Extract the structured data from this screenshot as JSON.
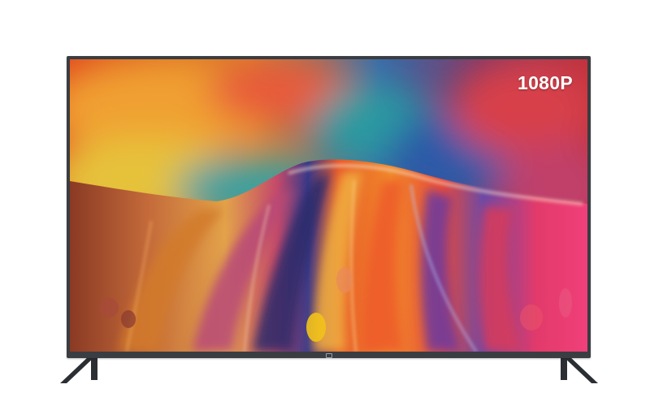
{
  "screen": {
    "resolution_label": "1080P"
  },
  "colors": {
    "bezel": "#3a3d42",
    "stand": "#2b2e33",
    "label": "#ffffff"
  },
  "icons": {
    "brand_logo": "mi-logo-icon"
  }
}
